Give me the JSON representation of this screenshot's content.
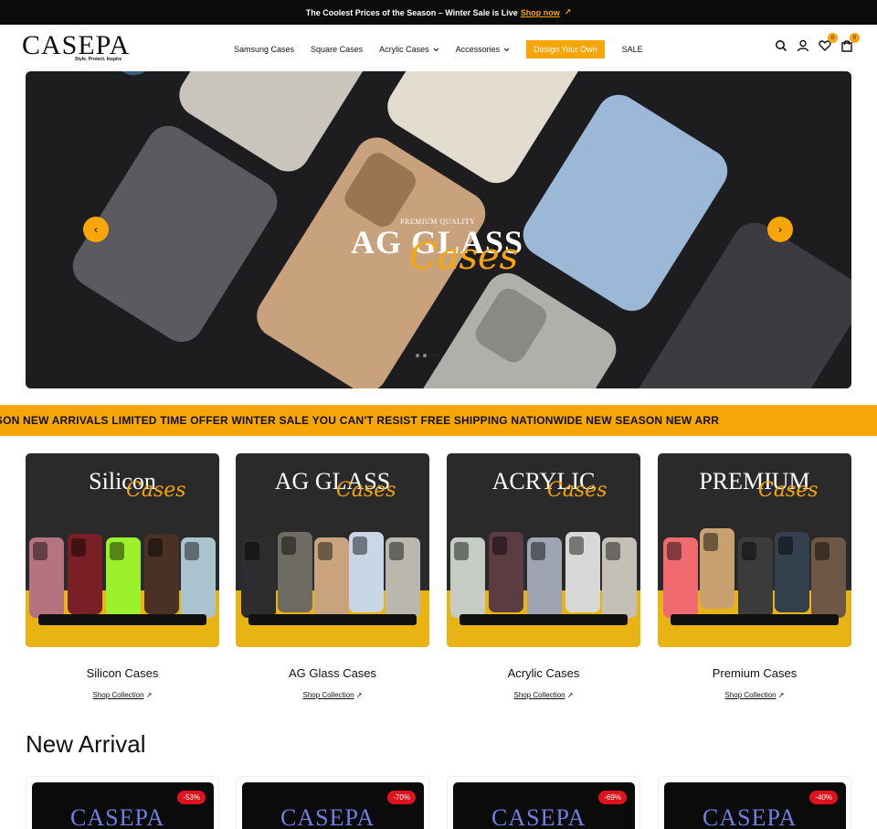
{
  "announcement": {
    "text": "The Coolest Prices of the Season – Winter Sale is Live",
    "link": "Shop now",
    "arrow": "↗"
  },
  "brand": {
    "logo": "CASEPA",
    "tagline": "Style. Protect. Inspire",
    "accent": "#f6a609"
  },
  "nav": {
    "items": [
      "Samsung Cases",
      "Square Cases",
      "Acrylic Cases",
      "Accessories",
      "Design Your Own",
      "SALE"
    ],
    "chevron": "⌄"
  },
  "header_icons": {
    "search": "search-icon",
    "account": "user-icon",
    "wishlist": "heart-icon",
    "wishlist_count": "0",
    "cart": "bag-icon",
    "cart_count": "0"
  },
  "hero": {
    "tag": "PREMIUM QUALITY",
    "title": "AG GLASS",
    "script": "Cases",
    "prev": "‹",
    "next": "›"
  },
  "marquee": {
    "text": "ASON NEW ARRIVALS LIMITED TIME OFFER WINTER SALE YOU CAN'T RESIST FREE SHIPPING NATIONWIDE NEW SEASON NEW ARR"
  },
  "collections": [
    {
      "main": "Silicon",
      "script": "Cases",
      "name": "Silicon Cases",
      "link": "Shop Collection",
      "arrow": "↗"
    },
    {
      "main": "AG GLASS",
      "script": "Cases",
      "name": "AG Glass Cases",
      "link": "Shop Collection",
      "arrow": "↗"
    },
    {
      "main": "ACRYLIC",
      "script": "Cases",
      "name": "Acrylic Cases",
      "link": "Shop Collection",
      "arrow": "↗"
    },
    {
      "main": "PREMIUM",
      "script": "Cases",
      "name": "Premium Cases",
      "link": "Shop Collection",
      "arrow": "↗"
    }
  ],
  "new_arrival": {
    "title": "New Arrival",
    "products": [
      {
        "brand": "CASEPA",
        "discount": "-53%"
      },
      {
        "brand": "CASEPA",
        "discount": "-70%"
      },
      {
        "brand": "CASEPA",
        "discount": "-69%"
      },
      {
        "brand": "CASEPA",
        "discount": "-40%"
      }
    ]
  }
}
